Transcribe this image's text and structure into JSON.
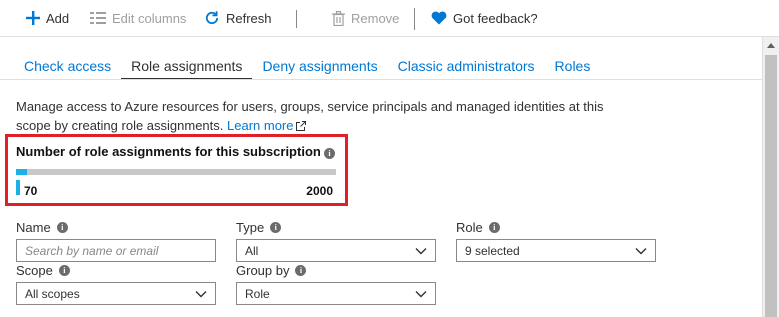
{
  "toolbar": {
    "add_label": "Add",
    "edit_columns_label": "Edit columns",
    "refresh_label": "Refresh",
    "remove_label": "Remove",
    "feedback_label": "Got feedback?"
  },
  "tabs": [
    {
      "label": "Check access",
      "active": false
    },
    {
      "label": "Role assignments",
      "active": true
    },
    {
      "label": "Deny assignments",
      "active": false
    },
    {
      "label": "Classic administrators",
      "active": false
    },
    {
      "label": "Roles",
      "active": false
    }
  ],
  "description": {
    "text": "Manage access to Azure resources for users, groups, service principals and managed identities at this scope by creating role assignments.",
    "link": "Learn more"
  },
  "usage": {
    "title": "Number of role assignments for this subscription",
    "current": "70",
    "max": "2000",
    "fraction": 0.035
  },
  "filters": {
    "name": {
      "label": "Name",
      "placeholder": "Search by name or email",
      "value": ""
    },
    "type": {
      "label": "Type",
      "value": "All"
    },
    "role": {
      "label": "Role",
      "value": "9 selected"
    },
    "scope": {
      "label": "Scope",
      "value": "All scopes"
    },
    "group_by": {
      "label": "Group by",
      "value": "Role"
    }
  },
  "colors": {
    "accent": "#0078d4",
    "heart": "#0078d4",
    "highlight_border": "#e01f26",
    "bar_fill": "#1ab1e6",
    "bar_track": "#c8c8c8"
  },
  "icons": {
    "add": "plus-icon",
    "edit_columns": "columns-icon",
    "refresh": "refresh-icon",
    "remove": "trash-icon",
    "feedback": "heart-icon",
    "info": "info-icon",
    "external": "external-link-icon",
    "dropdown": "chevron-down-icon"
  }
}
